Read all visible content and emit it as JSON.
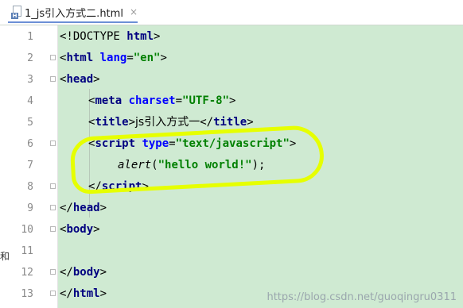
{
  "tab": {
    "icon": "html-file-icon",
    "title": "1_js引入方式二.html",
    "close": "×"
  },
  "lines": [
    {
      "num": "1"
    },
    {
      "num": "2"
    },
    {
      "num": "3"
    },
    {
      "num": "4"
    },
    {
      "num": "5"
    },
    {
      "num": "6"
    },
    {
      "num": "7"
    },
    {
      "num": "8"
    },
    {
      "num": "9"
    },
    {
      "num": "10"
    },
    {
      "num": "11"
    },
    {
      "num": "12"
    },
    {
      "num": "13"
    }
  ],
  "code": {
    "l1": {
      "a": "<!DOCTYPE ",
      "b": "html",
      "c": ">"
    },
    "l2": {
      "a": "<",
      "b": "html",
      "c": " lang",
      "d": "=",
      "e": "\"en\"",
      "f": ">"
    },
    "l3": {
      "a": "<",
      "b": "head",
      "c": ">"
    },
    "l4": {
      "a": "<",
      "b": "meta",
      "c": " charset",
      "d": "=",
      "e": "\"UTF-8\"",
      "f": ">"
    },
    "l5": {
      "a": "<",
      "b": "title",
      "c": ">",
      "d": "js引入方式一",
      "e": "</",
      "f": "title",
      "g": ">"
    },
    "l6": {
      "a": "<",
      "b": "script",
      "c": " type",
      "d": "=",
      "e": "\"text/javascript\"",
      "f": ">"
    },
    "l7": {
      "a": "alert",
      "b": "(",
      "c": "\"hello world!\"",
      "d": ");"
    },
    "l8": {
      "a": "</",
      "b": "script",
      "c": ">"
    },
    "l9": {
      "a": "</",
      "b": "head",
      "c": ">"
    },
    "l10": {
      "a": "<",
      "b": "body",
      "c": ">"
    },
    "l12": {
      "a": "</",
      "b": "body",
      "c": ">"
    },
    "l13": {
      "a": "</",
      "b": "html",
      "c": ">"
    }
  },
  "side_char": "和",
  "watermark": "https://blog.csdn.net/guoqingru0311",
  "colors": {
    "editor_bg": "#cfead2",
    "highlight": "#e6ff00",
    "tag": "#000080",
    "string": "#008000"
  }
}
